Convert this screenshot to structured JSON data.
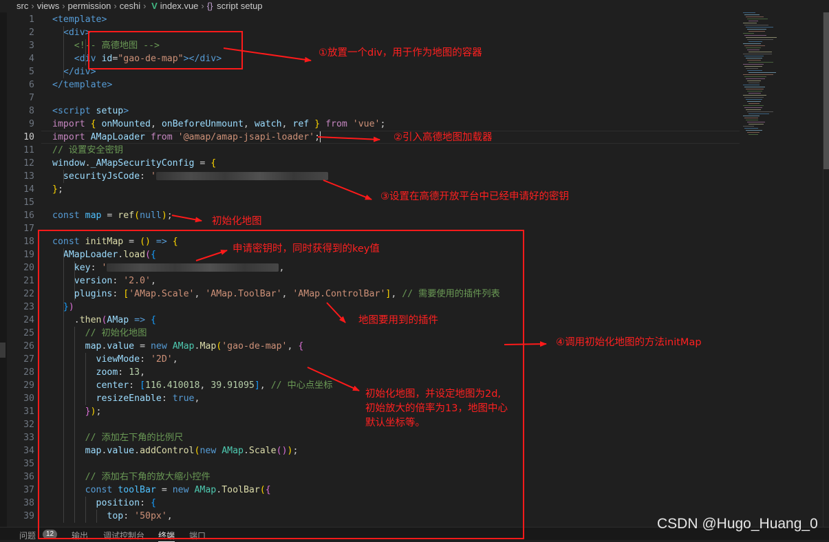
{
  "breadcrumb": {
    "items": [
      "src",
      "views",
      "permission",
      "ceshi"
    ],
    "file": "index.vue",
    "symbol_glyph": "{}",
    "symbol": "script setup"
  },
  "editor": {
    "active_line": 10,
    "lines": [
      {
        "n": 1,
        "tokens": [
          [
            "t-tag",
            "<template>"
          ]
        ]
      },
      {
        "n": 2,
        "tokens": [
          [
            "t-def",
            "  "
          ],
          [
            "t-tag",
            "<div>"
          ]
        ]
      },
      {
        "n": 3,
        "tokens": [
          [
            "t-def",
            "    "
          ],
          [
            "t-com",
            "<!-- 高德地图 -->"
          ]
        ]
      },
      {
        "n": 4,
        "tokens": [
          [
            "t-def",
            "    "
          ],
          [
            "t-tag",
            "<div "
          ],
          [
            "t-attr",
            "id"
          ],
          [
            "t-def",
            "="
          ],
          [
            "t-str",
            "\"gao-de-map\""
          ],
          [
            "t-tag",
            "></div>"
          ]
        ]
      },
      {
        "n": 5,
        "tokens": [
          [
            "t-def",
            "  "
          ],
          [
            "t-tag",
            "</div>"
          ]
        ]
      },
      {
        "n": 6,
        "tokens": [
          [
            "t-tag",
            "</template>"
          ]
        ]
      },
      {
        "n": 7,
        "tokens": []
      },
      {
        "n": 8,
        "tokens": [
          [
            "t-tag",
            "<script "
          ],
          [
            "t-attr",
            "setup"
          ],
          [
            "t-tag",
            ">"
          ]
        ]
      },
      {
        "n": 9,
        "tokens": [
          [
            "t-ctrl",
            "import "
          ],
          [
            "t-br1",
            "{ "
          ],
          [
            "t-var",
            "onMounted"
          ],
          [
            "t-def",
            ", "
          ],
          [
            "t-var",
            "onBeforeUnmount"
          ],
          [
            "t-def",
            ", "
          ],
          [
            "t-var",
            "watch"
          ],
          [
            "t-def",
            ", "
          ],
          [
            "t-var",
            "ref "
          ],
          [
            "t-br1",
            "} "
          ],
          [
            "t-ctrl",
            "from "
          ],
          [
            "t-str",
            "'vue'"
          ],
          [
            "t-def",
            ";"
          ]
        ]
      },
      {
        "n": 10,
        "tokens": [
          [
            "t-ctrl",
            "import "
          ],
          [
            "t-var",
            "AMapLoader "
          ],
          [
            "t-ctrl",
            "from "
          ],
          [
            "t-str",
            "'@amap/amap-jsapi-loader'"
          ],
          [
            "t-def",
            ";"
          ]
        ],
        "cursor": true
      },
      {
        "n": 11,
        "tokens": [
          [
            "t-com",
            "// 设置安全密钥"
          ]
        ]
      },
      {
        "n": 12,
        "tokens": [
          [
            "t-var",
            "window"
          ],
          [
            "t-def",
            "."
          ],
          [
            "t-var",
            "_AMapSecurityConfig "
          ],
          [
            "t-def",
            "= "
          ],
          [
            "t-br1",
            "{"
          ]
        ]
      },
      {
        "n": 13,
        "tokens": [
          [
            "t-def",
            "  "
          ],
          [
            "t-var",
            "securityJsCode"
          ],
          [
            "t-def",
            ": "
          ],
          [
            "t-str",
            "'"
          ]
        ],
        "blur": 250
      },
      {
        "n": 14,
        "tokens": [
          [
            "t-br1",
            "}"
          ],
          [
            "t-def",
            ";"
          ]
        ]
      },
      {
        "n": 15,
        "tokens": []
      },
      {
        "n": 16,
        "tokens": [
          [
            "t-kw",
            "const "
          ],
          [
            "t-const",
            "map "
          ],
          [
            "t-def",
            "= "
          ],
          [
            "t-fn",
            "ref"
          ],
          [
            "t-br1",
            "("
          ],
          [
            "t-kw",
            "null"
          ],
          [
            "t-br1",
            ")"
          ],
          [
            "t-def",
            ";"
          ]
        ]
      },
      {
        "n": 17,
        "tokens": []
      },
      {
        "n": 18,
        "tokens": [
          [
            "t-kw",
            "const "
          ],
          [
            "t-fn",
            "initMap "
          ],
          [
            "t-def",
            "= "
          ],
          [
            "t-br1",
            "() "
          ],
          [
            "t-kw",
            "=> "
          ],
          [
            "t-br1",
            "{"
          ]
        ]
      },
      {
        "n": 19,
        "tokens": [
          [
            "t-def",
            "  "
          ],
          [
            "t-var",
            "AMapLoader"
          ],
          [
            "t-def",
            "."
          ],
          [
            "t-fn",
            "load"
          ],
          [
            "t-br2",
            "("
          ],
          [
            "t-br3",
            "{"
          ]
        ]
      },
      {
        "n": 20,
        "tokens": [
          [
            "t-def",
            "    "
          ],
          [
            "t-var",
            "key"
          ],
          [
            "t-def",
            ": "
          ],
          [
            "t-str",
            "'"
          ]
        ],
        "blur": 250,
        "tail": ","
      },
      {
        "n": 21,
        "tokens": [
          [
            "t-def",
            "    "
          ],
          [
            "t-var",
            "version"
          ],
          [
            "t-def",
            ": "
          ],
          [
            "t-str",
            "'2.0'"
          ],
          [
            "t-def",
            ","
          ]
        ]
      },
      {
        "n": 22,
        "tokens": [
          [
            "t-def",
            "    "
          ],
          [
            "t-var",
            "plugins"
          ],
          [
            "t-def",
            ": "
          ],
          [
            "t-br1",
            "["
          ],
          [
            "t-str",
            "'AMap.Scale'"
          ],
          [
            "t-def",
            ", "
          ],
          [
            "t-str",
            "'AMap.ToolBar'"
          ],
          [
            "t-def",
            ", "
          ],
          [
            "t-str",
            "'AMap.ControlBar'"
          ],
          [
            "t-br1",
            "]"
          ],
          [
            "t-def",
            ", "
          ],
          [
            "t-com",
            "// 需要使用的插件列表"
          ]
        ]
      },
      {
        "n": 23,
        "tokens": [
          [
            "t-def",
            "  "
          ],
          [
            "t-br3",
            "}"
          ],
          [
            "t-br2",
            ")"
          ]
        ]
      },
      {
        "n": 24,
        "tokens": [
          [
            "t-def",
            "    ."
          ],
          [
            "t-fn",
            "then"
          ],
          [
            "t-br2",
            "("
          ],
          [
            "t-var",
            "AMap "
          ],
          [
            "t-kw",
            "=> "
          ],
          [
            "t-br3",
            "{"
          ]
        ]
      },
      {
        "n": 25,
        "tokens": [
          [
            "t-def",
            "      "
          ],
          [
            "t-com",
            "// 初始化地图"
          ]
        ]
      },
      {
        "n": 26,
        "tokens": [
          [
            "t-def",
            "      "
          ],
          [
            "t-var",
            "map"
          ],
          [
            "t-def",
            "."
          ],
          [
            "t-var",
            "value "
          ],
          [
            "t-def",
            "= "
          ],
          [
            "t-kw",
            "new "
          ],
          [
            "t-cls",
            "AMap"
          ],
          [
            "t-def",
            "."
          ],
          [
            "t-fn",
            "Map"
          ],
          [
            "t-br1",
            "("
          ],
          [
            "t-str",
            "'gao-de-map'"
          ],
          [
            "t-def",
            ", "
          ],
          [
            "t-br2",
            "{"
          ]
        ]
      },
      {
        "n": 27,
        "tokens": [
          [
            "t-def",
            "        "
          ],
          [
            "t-var",
            "viewMode"
          ],
          [
            "t-def",
            ": "
          ],
          [
            "t-str",
            "'2D'"
          ],
          [
            "t-def",
            ","
          ]
        ]
      },
      {
        "n": 28,
        "tokens": [
          [
            "t-def",
            "        "
          ],
          [
            "t-var",
            "zoom"
          ],
          [
            "t-def",
            ": "
          ],
          [
            "t-num",
            "13"
          ],
          [
            "t-def",
            ","
          ]
        ]
      },
      {
        "n": 29,
        "tokens": [
          [
            "t-def",
            "        "
          ],
          [
            "t-var",
            "center"
          ],
          [
            "t-def",
            ": "
          ],
          [
            "t-br3",
            "["
          ],
          [
            "t-num",
            "116.410018"
          ],
          [
            "t-def",
            ", "
          ],
          [
            "t-num",
            "39.91095"
          ],
          [
            "t-br3",
            "]"
          ],
          [
            "t-def",
            ", "
          ],
          [
            "t-com",
            "// 中心点坐标"
          ]
        ]
      },
      {
        "n": 30,
        "tokens": [
          [
            "t-def",
            "        "
          ],
          [
            "t-var",
            "resizeEnable"
          ],
          [
            "t-def",
            ": "
          ],
          [
            "t-kw",
            "true"
          ],
          [
            "t-def",
            ","
          ]
        ]
      },
      {
        "n": 31,
        "tokens": [
          [
            "t-def",
            "      "
          ],
          [
            "t-br2",
            "}"
          ],
          [
            "t-br1",
            ")"
          ],
          [
            "t-def",
            ";"
          ]
        ]
      },
      {
        "n": 32,
        "tokens": []
      },
      {
        "n": 33,
        "tokens": [
          [
            "t-def",
            "      "
          ],
          [
            "t-com",
            "// 添加左下角的比例尺"
          ]
        ]
      },
      {
        "n": 34,
        "tokens": [
          [
            "t-def",
            "      "
          ],
          [
            "t-var",
            "map"
          ],
          [
            "t-def",
            "."
          ],
          [
            "t-var",
            "value"
          ],
          [
            "t-def",
            "."
          ],
          [
            "t-fn",
            "addControl"
          ],
          [
            "t-br1",
            "("
          ],
          [
            "t-kw",
            "new "
          ],
          [
            "t-cls",
            "AMap"
          ],
          [
            "t-def",
            "."
          ],
          [
            "t-fn",
            "Scale"
          ],
          [
            "t-br2",
            "()"
          ],
          [
            "t-br1",
            ")"
          ],
          [
            "t-def",
            ";"
          ]
        ]
      },
      {
        "n": 35,
        "tokens": []
      },
      {
        "n": 36,
        "tokens": [
          [
            "t-def",
            "      "
          ],
          [
            "t-com",
            "// 添加右下角的放大缩小控件"
          ]
        ]
      },
      {
        "n": 37,
        "tokens": [
          [
            "t-def",
            "      "
          ],
          [
            "t-kw",
            "const "
          ],
          [
            "t-const",
            "toolBar "
          ],
          [
            "t-def",
            "= "
          ],
          [
            "t-kw",
            "new "
          ],
          [
            "t-cls",
            "AMap"
          ],
          [
            "t-def",
            "."
          ],
          [
            "t-fn",
            "ToolBar"
          ],
          [
            "t-br1",
            "("
          ],
          [
            "t-br2",
            "{"
          ]
        ]
      },
      {
        "n": 38,
        "tokens": [
          [
            "t-def",
            "        "
          ],
          [
            "t-var",
            "position"
          ],
          [
            "t-def",
            ": "
          ],
          [
            "t-br3",
            "{"
          ]
        ]
      },
      {
        "n": 39,
        "tokens": [
          [
            "t-def",
            "          "
          ],
          [
            "t-var",
            "top"
          ],
          [
            "t-def",
            ": "
          ],
          [
            "t-str",
            "'50px'"
          ],
          [
            "t-def",
            ","
          ]
        ]
      }
    ]
  },
  "annotations": {
    "a1": "①放置一个div，用于作为地图的容器",
    "a2": "②引入高德地图加载器",
    "a3": "③设置在高德开放平台中已经申请好的密钥",
    "a4": "初始化地图",
    "a5": "申请密钥时，同时获得到的key值",
    "a6": "地图要用到的插件",
    "a7": "④调用初始化地图的方法initMap",
    "a8_lines": [
      "初始化地图，并设定地图为2d,",
      "初始放大的倍率为13，地图中心",
      "默认坐标等。"
    ]
  },
  "panel": {
    "problems": "问题",
    "problems_count": "12",
    "output": "输出",
    "debug_console": "调试控制台",
    "terminal": "终端",
    "ports": "端口"
  },
  "watermark": "CSDN @Hugo_Huang_0"
}
